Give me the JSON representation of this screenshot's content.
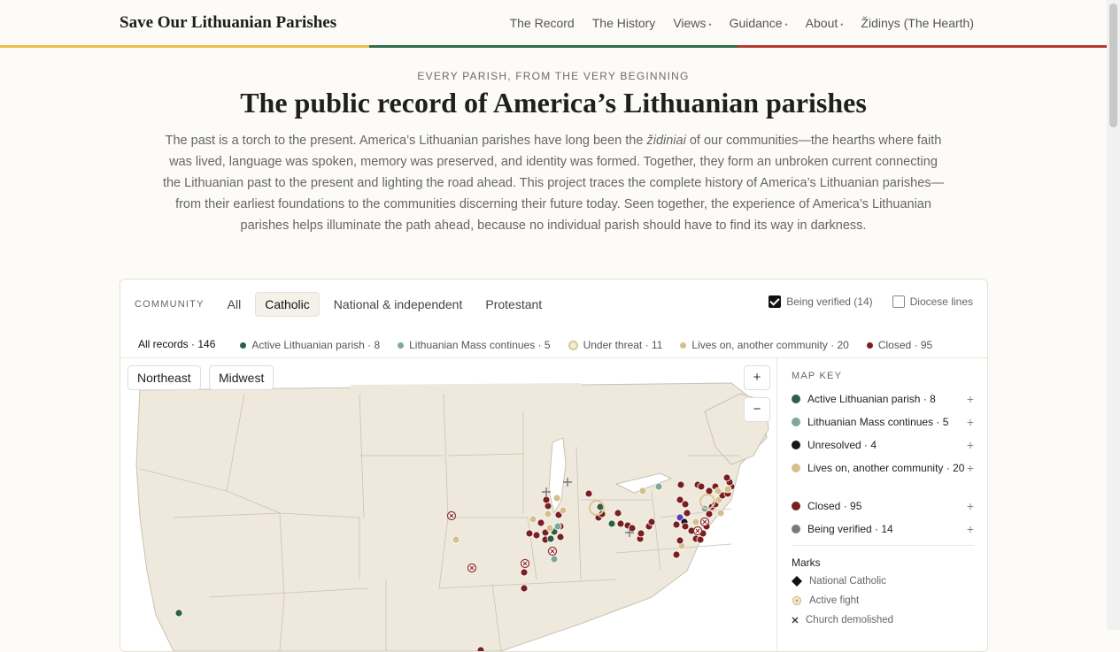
{
  "brand": "Save Our Lithuanian Parishes",
  "nav": [
    {
      "label": "The Record",
      "caret": false
    },
    {
      "label": "The History",
      "caret": false
    },
    {
      "label": "Views",
      "caret": true
    },
    {
      "label": "Guidance",
      "caret": true
    },
    {
      "label": "About",
      "caret": true
    },
    {
      "label": "Židinys (The Hearth)",
      "caret": false
    }
  ],
  "colors": {
    "yellow": "#e8c04e",
    "green": "#2f6e4a",
    "red": "#b53a34"
  },
  "hero": {
    "eyebrow": "EVERY PARISH, FROM THE VERY BEGINNING",
    "title": "The public record of America’s Lithuanian parishes",
    "intro_before": "The past is a torch to the present. America’s Lithuanian parishes have long been the ",
    "intro_em": "židiniai",
    "intro_after": " of our communities—the hearths where faith was lived, language was spoken, memory was preserved, and identity was formed. Together, they form an unbroken current connecting the Lithuanian past to the present and lighting the road ahead. This project traces the complete history of America’s Lithuanian parishes—from their earliest foundations to the communities discerning their future today. Seen together, the experience of America’s Lithuanian parishes helps illuminate the path ahead, because no individual parish should have to find its way in darkness."
  },
  "community": {
    "label": "COMMUNITY",
    "tabs": [
      "All",
      "Catholic",
      "National & independent",
      "Protestant"
    ],
    "active_tab": "Catholic"
  },
  "toggles": {
    "verified": {
      "label": "Being verified (14)",
      "checked": true
    },
    "diocese": {
      "label": "Diocese lines",
      "checked": false
    }
  },
  "filters": [
    {
      "label": "All records · 146",
      "color": "",
      "active": true
    },
    {
      "label": "Active Lithuanian parish · 8",
      "color": "#2f5e45",
      "active": false
    },
    {
      "label": "Lithuanian Mass continues · 5",
      "color": "#7fa996",
      "active": false
    },
    {
      "label": "Under threat · 11",
      "color": "ring",
      "active": false
    },
    {
      "label": "Lives on, another community · 20",
      "color": "#d4c08a",
      "active": false
    },
    {
      "label": "Closed · 95",
      "color": "#7a1f1f",
      "active": false
    }
  ],
  "map": {
    "regions": [
      "Northeast",
      "Midwest"
    ],
    "zoom_in": "+",
    "zoom_out": "−"
  },
  "key": {
    "title": "MAP KEY",
    "items": [
      {
        "label": "Active Lithuanian parish · 8",
        "color": "#2f5e45"
      },
      {
        "label": "Lithuanian Mass continues · 5",
        "color": "#7fa996"
      },
      {
        "label": "Unresolved · 4",
        "color": "#161616"
      },
      {
        "label": "Lives on, another community · 20",
        "color": "#d4c08a"
      },
      {
        "label": "Closed · 95",
        "color": "#7a1f1f"
      },
      {
        "label": "Being verified · 14",
        "color": "#7a7a7a"
      }
    ],
    "plus": "+",
    "marks_title": "Marks",
    "marks": [
      {
        "label": "National Catholic",
        "icon": "diamond-icon"
      },
      {
        "label": "Active fight",
        "icon": "ring-icon"
      },
      {
        "label": "Church demolished",
        "icon": "x-icon"
      }
    ]
  }
}
